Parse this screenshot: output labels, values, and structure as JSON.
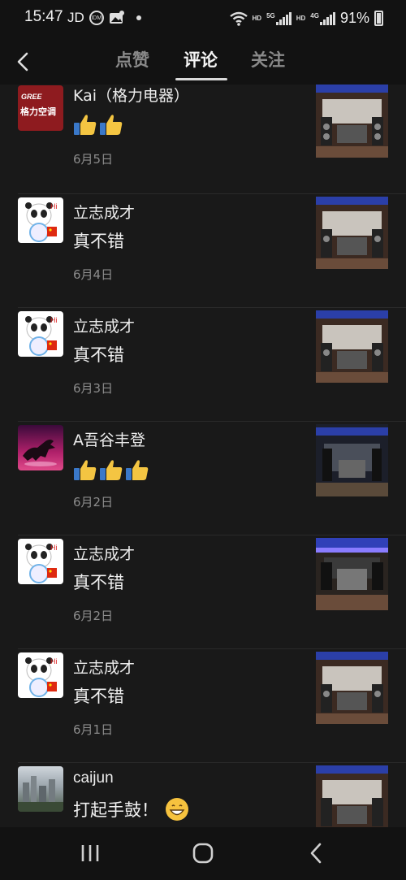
{
  "status_bar": {
    "time": "15:47",
    "carrier": "JD",
    "battery_percent": "91%",
    "network_labels": [
      "HD",
      "5G",
      "HD",
      "4G"
    ]
  },
  "header": {
    "back_icon": "chevron-left-icon",
    "tabs": [
      {
        "label": "点赞",
        "active": false
      },
      {
        "label": "评论",
        "active": true
      },
      {
        "label": "关注",
        "active": false
      }
    ]
  },
  "comments": [
    {
      "user": "Kai（格力电器）",
      "avatar": "gree-logo",
      "avatar_text": "格力空调",
      "avatar_brand": "GREE",
      "content": "",
      "emoji_count": 2,
      "emoji": "thumbs-up-icon",
      "date": "6月5日"
    },
    {
      "user": "立志成才",
      "avatar": "panda-mascot",
      "content": "真不错",
      "emoji_count": 0,
      "date": "6月4日"
    },
    {
      "user": "立志成才",
      "avatar": "panda-mascot",
      "content": "真不错",
      "emoji_count": 0,
      "date": "6月3日"
    },
    {
      "user": "A吾谷丰登",
      "avatar": "horse",
      "content": "",
      "emoji_count": 3,
      "emoji": "thumbs-up-icon",
      "date": "6月2日"
    },
    {
      "user": "立志成才",
      "avatar": "panda-mascot",
      "content": "真不错",
      "emoji_count": 0,
      "date": "6月2日"
    },
    {
      "user": "立志成才",
      "avatar": "panda-mascot",
      "content": "真不错",
      "emoji_count": 0,
      "date": "6月1日"
    },
    {
      "user": "caijun",
      "avatar": "city-photo",
      "content": "打起手鼓！",
      "emoji_count": 1,
      "emoji": "grinning-face-icon",
      "date": ""
    }
  ],
  "nav_bar": {
    "buttons": [
      "recent-apps-icon",
      "home-icon",
      "back-icon"
    ]
  },
  "colors": {
    "background": "#191919",
    "bar": "#121212",
    "text": "#f0f0f0",
    "muted": "#8c8c8c"
  }
}
